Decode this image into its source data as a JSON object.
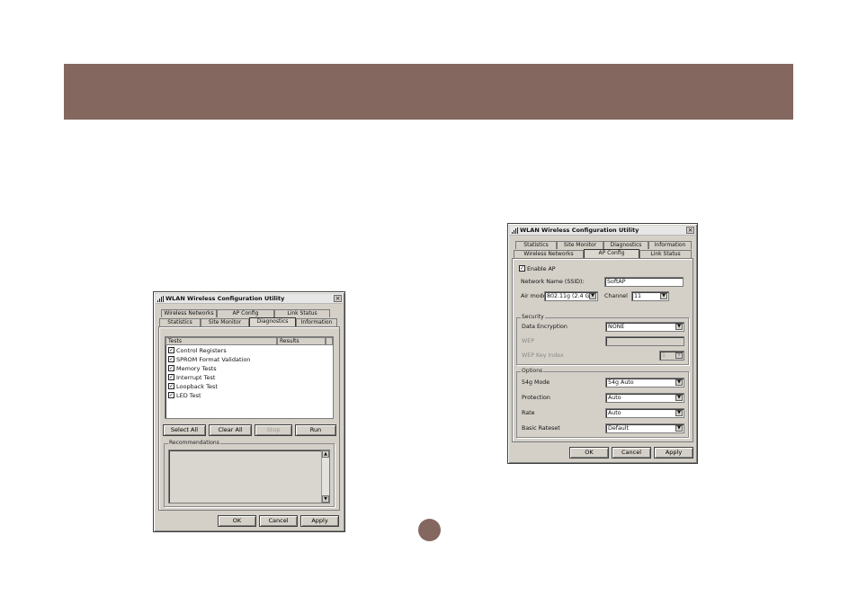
{
  "colors": {
    "banner": "#84675f",
    "page_dot": "#84675f"
  },
  "left_window": {
    "title": "WLAN Wireless Configuration Utility",
    "close": "×",
    "tabs_back": [
      "Wireless Networks",
      "AP Config",
      "Link Status"
    ],
    "tabs_front": [
      "Statistics",
      "Site Monitor",
      "Diagnostics",
      "Information"
    ],
    "active_tab": "Diagnostics",
    "columns": [
      "Tests",
      "Results"
    ],
    "tests": [
      {
        "label": "Control Registers",
        "checked": true
      },
      {
        "label": "SPROM Format Validation",
        "checked": true
      },
      {
        "label": "Memory Tests",
        "checked": true
      },
      {
        "label": "Interrupt Test",
        "checked": true
      },
      {
        "label": "Loopback Test",
        "checked": true
      },
      {
        "label": "LED  Test",
        "checked": true
      }
    ],
    "buttons": {
      "select_all": "Select All",
      "clear_all": "Clear All",
      "stop": "Stop",
      "run": "Run"
    },
    "recommendations_title": "Recommendations",
    "bottom": {
      "ok": "OK",
      "cancel": "Cancel",
      "apply": "Apply"
    }
  },
  "right_window": {
    "title": "WLAN Wireless Configuration Utility",
    "close": "×",
    "tabs_back": [
      "Statistics",
      "Site Monitor",
      "Diagnostics",
      "Information"
    ],
    "tabs_front": [
      "Wireless Networks",
      "AP Config",
      "Link Status"
    ],
    "active_tab": "AP Config",
    "enable_ap": {
      "label": "Enable AP",
      "checked": true
    },
    "ssid": {
      "label": "Network Name (SSID):",
      "value": "SoftAP"
    },
    "air_mode": {
      "label": "Air mode",
      "value": "802.11g (2.4 GH"
    },
    "channel": {
      "label": "Channel",
      "value": "11"
    },
    "security": {
      "title": "Security",
      "data_encryption": {
        "label": "Data Encryption",
        "value": "NONE"
      },
      "wep": {
        "label": "WEP",
        "value": ""
      },
      "wep_key_index": {
        "label": "WEP Key Index",
        "value": "1"
      }
    },
    "options": {
      "title": "Options",
      "mode_54g": {
        "label": "54g Mode",
        "value": "54g Auto"
      },
      "protection": {
        "label": "Protection",
        "value": "Auto"
      },
      "rate": {
        "label": "Rate",
        "value": "Auto"
      },
      "basic_rateset": {
        "label": "Basic Rateset",
        "value": "Default"
      }
    },
    "bottom": {
      "ok": "OK",
      "cancel": "Cancel",
      "apply": "Apply"
    }
  }
}
